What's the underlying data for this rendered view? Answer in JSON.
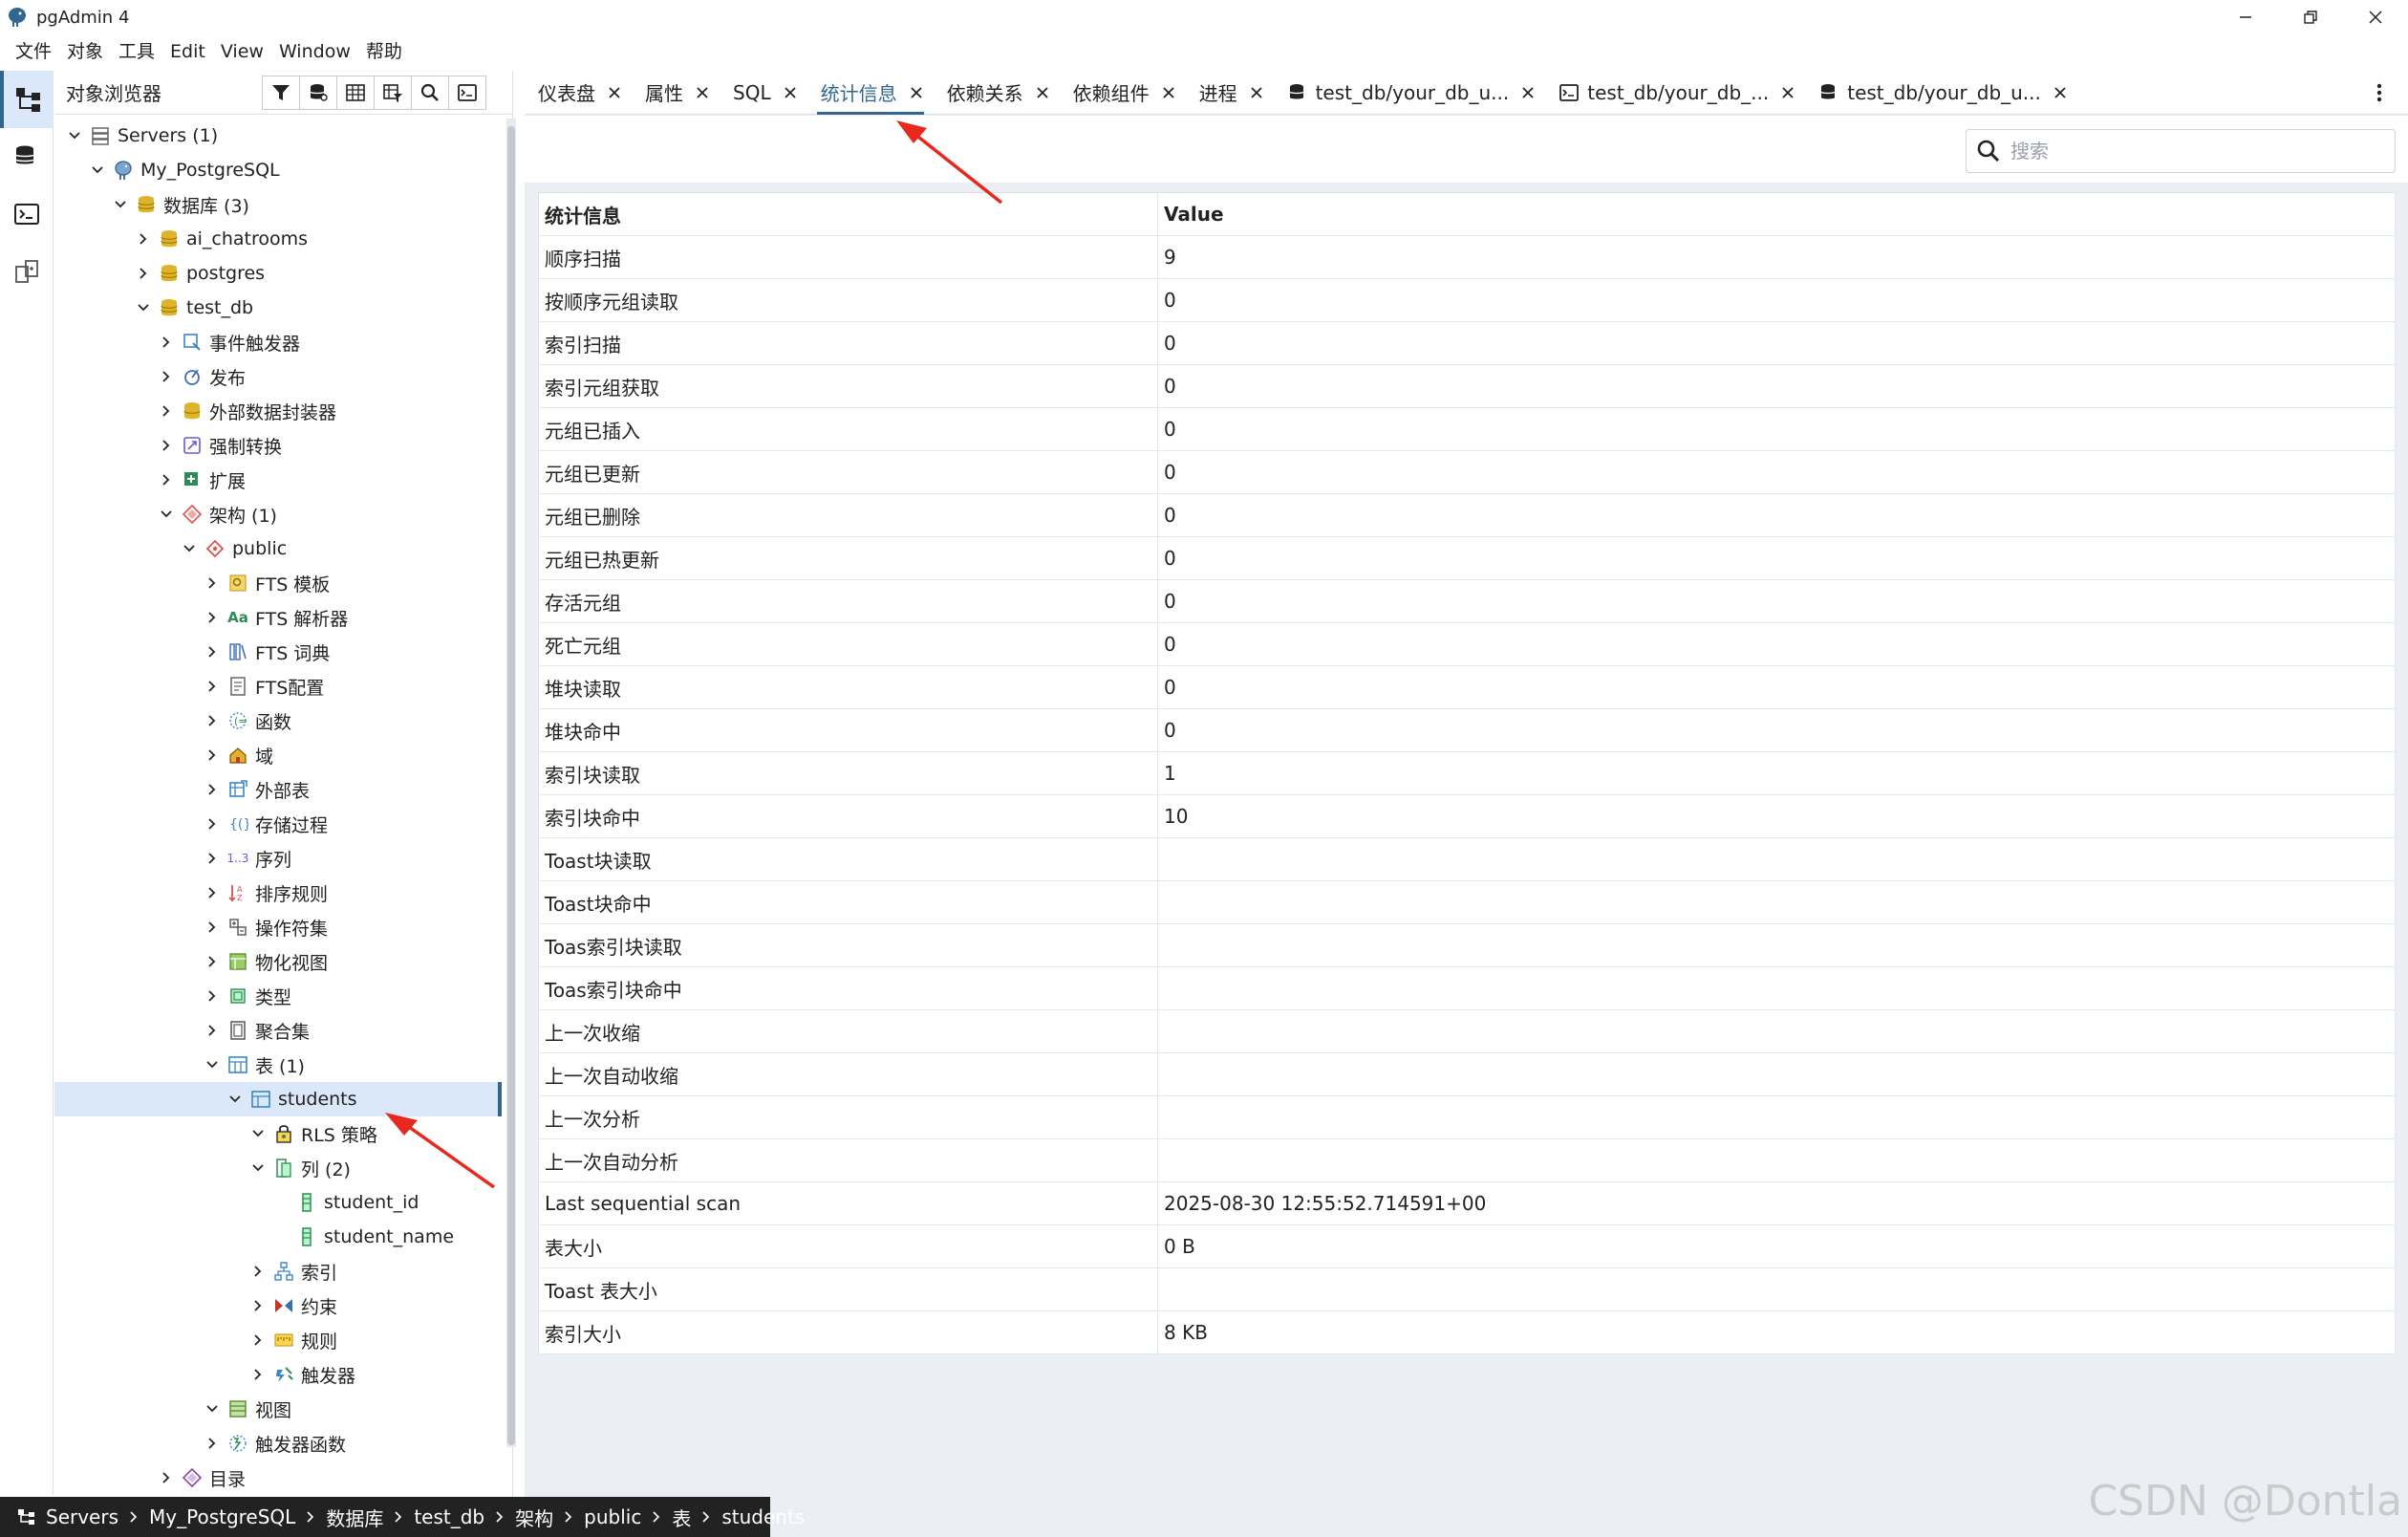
{
  "window": {
    "title": "pgAdmin 4"
  },
  "menu": [
    "文件",
    "对象",
    "工具",
    "Edit",
    "View",
    "Window",
    "帮助"
  ],
  "browser": {
    "title": "对象浏览器",
    "tools": [
      "filter-icon",
      "database-query-icon",
      "table-view-icon",
      "table-filter-icon",
      "search-icon",
      "terminal-icon"
    ],
    "tree": [
      {
        "label": "Servers (1)",
        "icon": "servers-icon",
        "depth": 0,
        "expanded": true
      },
      {
        "label": "My_PostgreSQL",
        "icon": "elephant-icon",
        "depth": 1,
        "expanded": true
      },
      {
        "label": "数据库 (3)",
        "icon": "databases-icon",
        "depth": 2,
        "expanded": true
      },
      {
        "label": "ai_chatrooms",
        "icon": "database-icon",
        "depth": 3,
        "expanded": false
      },
      {
        "label": "postgres",
        "icon": "database-icon",
        "depth": 3,
        "expanded": false
      },
      {
        "label": "test_db",
        "icon": "database-icon",
        "depth": 3,
        "expanded": true
      },
      {
        "label": "事件触发器",
        "icon": "event-trigger-icon",
        "depth": 4,
        "expanded": false
      },
      {
        "label": "发布",
        "icon": "publication-icon",
        "depth": 4,
        "expanded": false
      },
      {
        "label": "外部数据封装器",
        "icon": "fdw-icon",
        "depth": 4,
        "expanded": false
      },
      {
        "label": "强制转换",
        "icon": "cast-icon",
        "depth": 4,
        "expanded": false
      },
      {
        "label": "扩展",
        "icon": "extension-icon",
        "depth": 4,
        "expanded": false
      },
      {
        "label": "架构 (1)",
        "icon": "schemas-icon",
        "depth": 4,
        "expanded": true
      },
      {
        "label": "public",
        "icon": "schema-icon",
        "depth": 5,
        "expanded": true
      },
      {
        "label": "FTS 模板",
        "icon": "fts-template-icon",
        "depth": 6,
        "expanded": false
      },
      {
        "label": "FTS 解析器",
        "icon": "fts-parser-icon",
        "depth": 6,
        "expanded": false
      },
      {
        "label": "FTS 词典",
        "icon": "fts-dictionary-icon",
        "depth": 6,
        "expanded": false
      },
      {
        "label": "FTS配置",
        "icon": "fts-config-icon",
        "depth": 6,
        "expanded": false
      },
      {
        "label": "函数",
        "icon": "function-icon",
        "depth": 6,
        "expanded": false
      },
      {
        "label": "域",
        "icon": "domain-icon",
        "depth": 6,
        "expanded": false
      },
      {
        "label": "外部表",
        "icon": "foreign-table-icon",
        "depth": 6,
        "expanded": false
      },
      {
        "label": "存储过程",
        "icon": "procedure-icon",
        "depth": 6,
        "expanded": false
      },
      {
        "label": "序列",
        "icon": "sequence-icon",
        "depth": 6,
        "expanded": false
      },
      {
        "label": "排序规则",
        "icon": "collation-icon",
        "depth": 6,
        "expanded": false
      },
      {
        "label": "操作符集",
        "icon": "operator-icon",
        "depth": 6,
        "expanded": false
      },
      {
        "label": "物化视图",
        "icon": "matview-icon",
        "depth": 6,
        "expanded": false
      },
      {
        "label": "类型",
        "icon": "type-icon",
        "depth": 6,
        "expanded": false
      },
      {
        "label": "聚合集",
        "icon": "aggregate-icon",
        "depth": 6,
        "expanded": false
      },
      {
        "label": "表 (1)",
        "icon": "tables-icon",
        "depth": 6,
        "expanded": true
      },
      {
        "label": "students",
        "icon": "table-icon",
        "depth": 7,
        "expanded": true,
        "selected": true
      },
      {
        "label": "RLS 策略",
        "icon": "rls-policy-icon",
        "depth": 8,
        "expanded": true
      },
      {
        "label": "列 (2)",
        "icon": "columns-icon",
        "depth": 8,
        "expanded": true
      },
      {
        "label": "student_id",
        "icon": "column-icon",
        "depth": 9,
        "leaf": true
      },
      {
        "label": "student_name",
        "icon": "column-icon",
        "depth": 9,
        "leaf": true
      },
      {
        "label": "索引",
        "icon": "index-icon",
        "depth": 8,
        "expanded": false
      },
      {
        "label": "约束",
        "icon": "constraint-icon",
        "depth": 8,
        "expanded": false
      },
      {
        "label": "规则",
        "icon": "rule-icon",
        "depth": 8,
        "expanded": false
      },
      {
        "label": "触发器",
        "icon": "trigger-icon",
        "depth": 8,
        "expanded": false
      },
      {
        "label": "视图",
        "icon": "view-icon",
        "depth": 6,
        "expanded": true
      },
      {
        "label": "触发器函数",
        "icon": "trigger-function-icon",
        "depth": 6,
        "expanded": false
      },
      {
        "label": "目录",
        "icon": "catalog-icon",
        "depth": 4,
        "expanded": false
      }
    ]
  },
  "breadcrumb": [
    "Servers",
    "My_PostgreSQL",
    "数据库",
    "test_db",
    "架构",
    "public",
    "表",
    "students"
  ],
  "tabs": [
    {
      "label": "仪表盘",
      "icon": ""
    },
    {
      "label": "属性",
      "icon": ""
    },
    {
      "label": "SQL",
      "icon": ""
    },
    {
      "label": "统计信息",
      "icon": "",
      "active": true
    },
    {
      "label": "依赖关系",
      "icon": ""
    },
    {
      "label": "依赖组件",
      "icon": ""
    },
    {
      "label": "进程",
      "icon": ""
    },
    {
      "label": "test_db/your_db_u...",
      "icon": "query-tool-icon"
    },
    {
      "label": "test_db/your_db_...",
      "icon": "psql-icon"
    },
    {
      "label": "test_db/your_db_u...",
      "icon": "query-tool-icon"
    }
  ],
  "search": {
    "placeholder": "搜索",
    "value": ""
  },
  "stats": {
    "headers": [
      "统计信息",
      "Value"
    ],
    "rows": [
      [
        "顺序扫描",
        "9"
      ],
      [
        "按顺序元组读取",
        "0"
      ],
      [
        "索引扫描",
        "0"
      ],
      [
        "索引元组获取",
        "0"
      ],
      [
        "元组已插入",
        "0"
      ],
      [
        "元组已更新",
        "0"
      ],
      [
        "元组已删除",
        "0"
      ],
      [
        "元组已热更新",
        "0"
      ],
      [
        "存活元组",
        "0"
      ],
      [
        "死亡元组",
        "0"
      ],
      [
        "堆块读取",
        "0"
      ],
      [
        "堆块命中",
        "0"
      ],
      [
        "索引块读取",
        "1"
      ],
      [
        "索引块命中",
        "10"
      ],
      [
        "Toast块读取",
        ""
      ],
      [
        "Toast块命中",
        ""
      ],
      [
        "Toas索引块读取",
        ""
      ],
      [
        "Toas索引块命中",
        ""
      ],
      [
        "上一次收缩",
        ""
      ],
      [
        "上一次自动收缩",
        ""
      ],
      [
        "上一次分析",
        ""
      ],
      [
        "上一次自动分析",
        ""
      ],
      [
        "Last sequential scan",
        "2025-08-30 12:55:52.714591+00"
      ],
      [
        "表大小",
        "0 B"
      ],
      [
        "Toast 表大小",
        ""
      ],
      [
        "索引大小",
        "8 KB"
      ]
    ]
  },
  "watermark": "CSDN @Dontla",
  "colors": {
    "accent": "#326690",
    "selected_bg": "#dbe8f9",
    "panel_bg": "#ebeef3",
    "annotation_arrow": "#e8271d"
  }
}
